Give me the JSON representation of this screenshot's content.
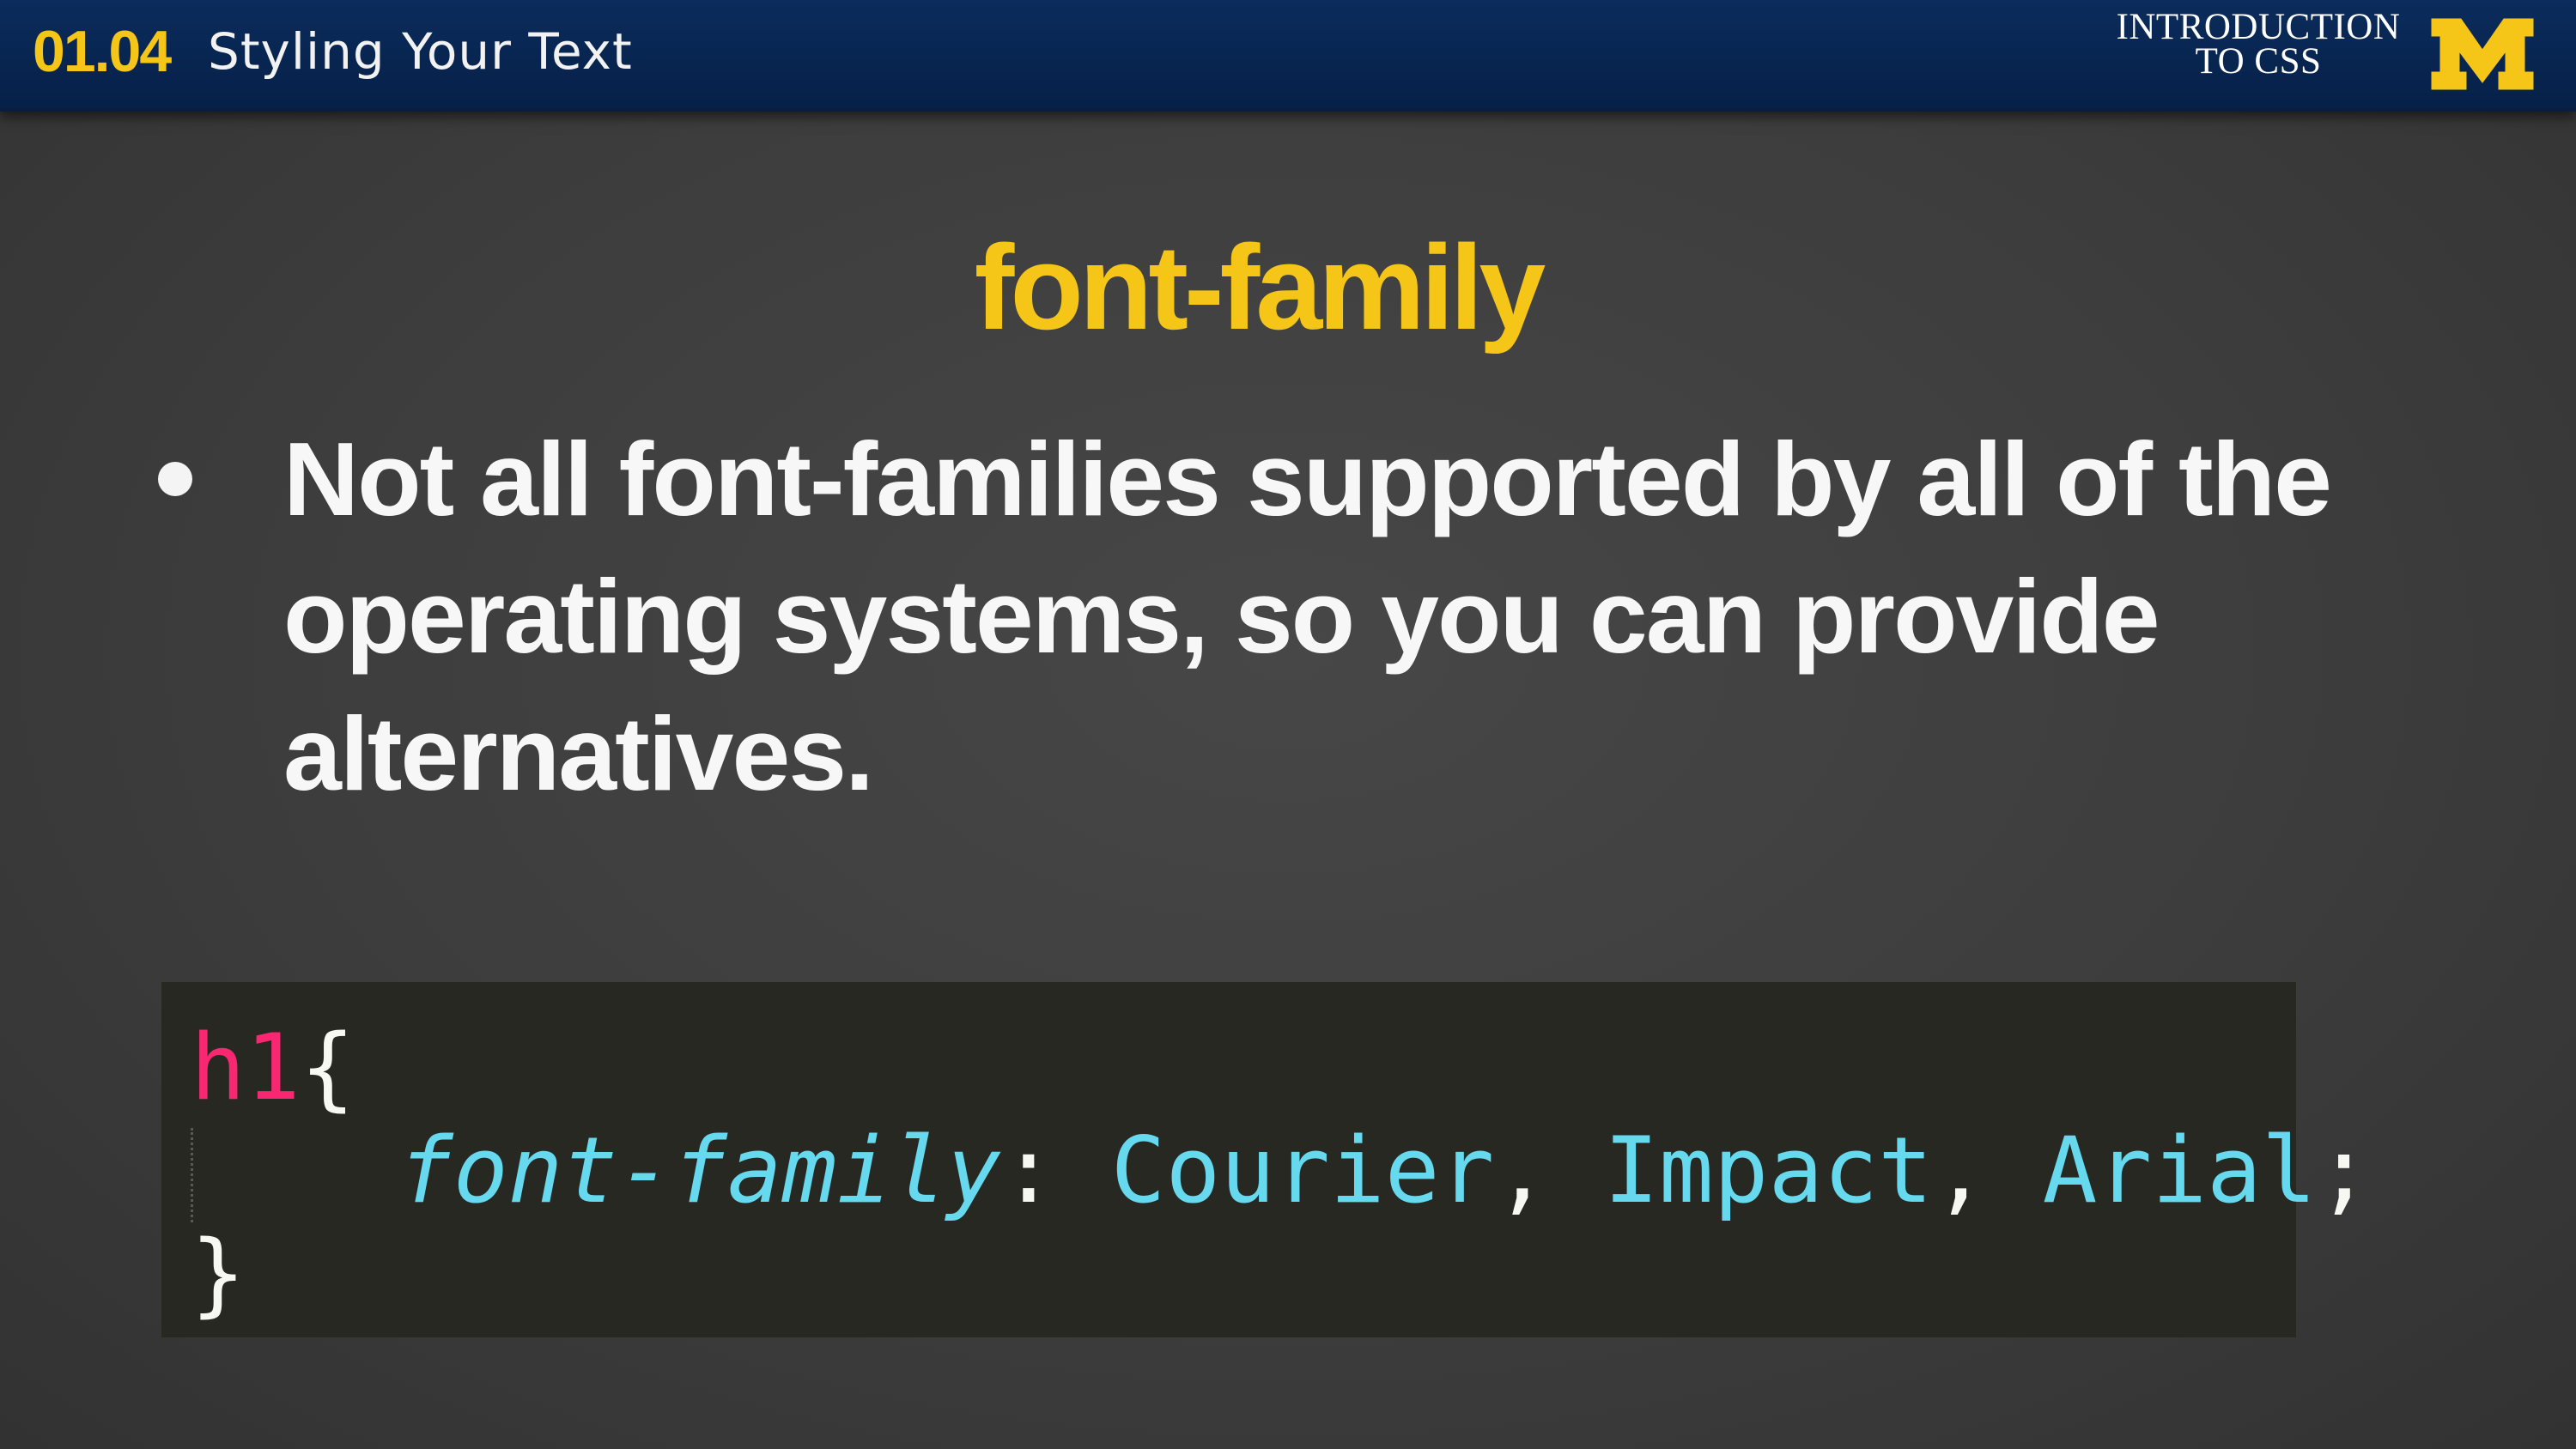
{
  "header": {
    "lesson_number": "01.04",
    "lesson_title": "Styling Your Text",
    "course_title_line1": "INTRODUCTION",
    "course_title_line2": "TO CSS",
    "logo_letter": "M",
    "accent_color": "#f5c518",
    "bar_color": "#062048"
  },
  "slide": {
    "heading": "font-family",
    "bullet": "Not all font-families supported by all of the operating systems, so you can provide alternatives."
  },
  "code": {
    "selector": "h1",
    "open_brace": "{",
    "property": "font-family",
    "colon": ":",
    "value1": "Courier",
    "comma1": ",",
    "value2": "Impact",
    "comma2": ",",
    "value3": "Arial",
    "semicolon": ";",
    "close_brace": "}",
    "colors": {
      "background": "#272822",
      "selector": "#f92672",
      "property": "#66d9ef",
      "text": "#f8f8f2"
    }
  }
}
